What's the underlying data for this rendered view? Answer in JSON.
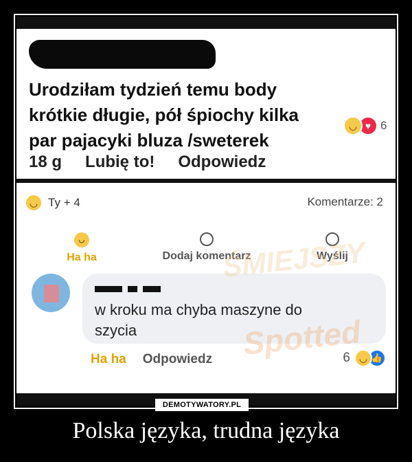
{
  "post": {
    "lines": [
      "Urodziłam tydzień temu body",
      "krótkie długie, pół śpiochy kilka",
      "par pajacyki bluza /sweterek"
    ],
    "reaction_count": "6",
    "time": "18 g",
    "like_label": "Lubię to!",
    "reply_label": "Odpowiedz"
  },
  "summary": {
    "reactors": "Ty + 4",
    "comments": "Komentarze: 2"
  },
  "actions": {
    "haha": "Ha ha",
    "comment": "Dodaj komentarz",
    "send": "Wyślij"
  },
  "comment": {
    "text_line1": "w kroku ma chyba maszyne do",
    "text_line2": "szycia",
    "haha": "Ha ha",
    "reply": "Odpowiedz",
    "reaction_count": "6"
  },
  "watermark": {
    "line1": "ŚMIEJSZY",
    "line2": "Spotted"
  },
  "brand": "DEMOTYWATORY.PL",
  "caption": "Polska języka, trudna języka"
}
